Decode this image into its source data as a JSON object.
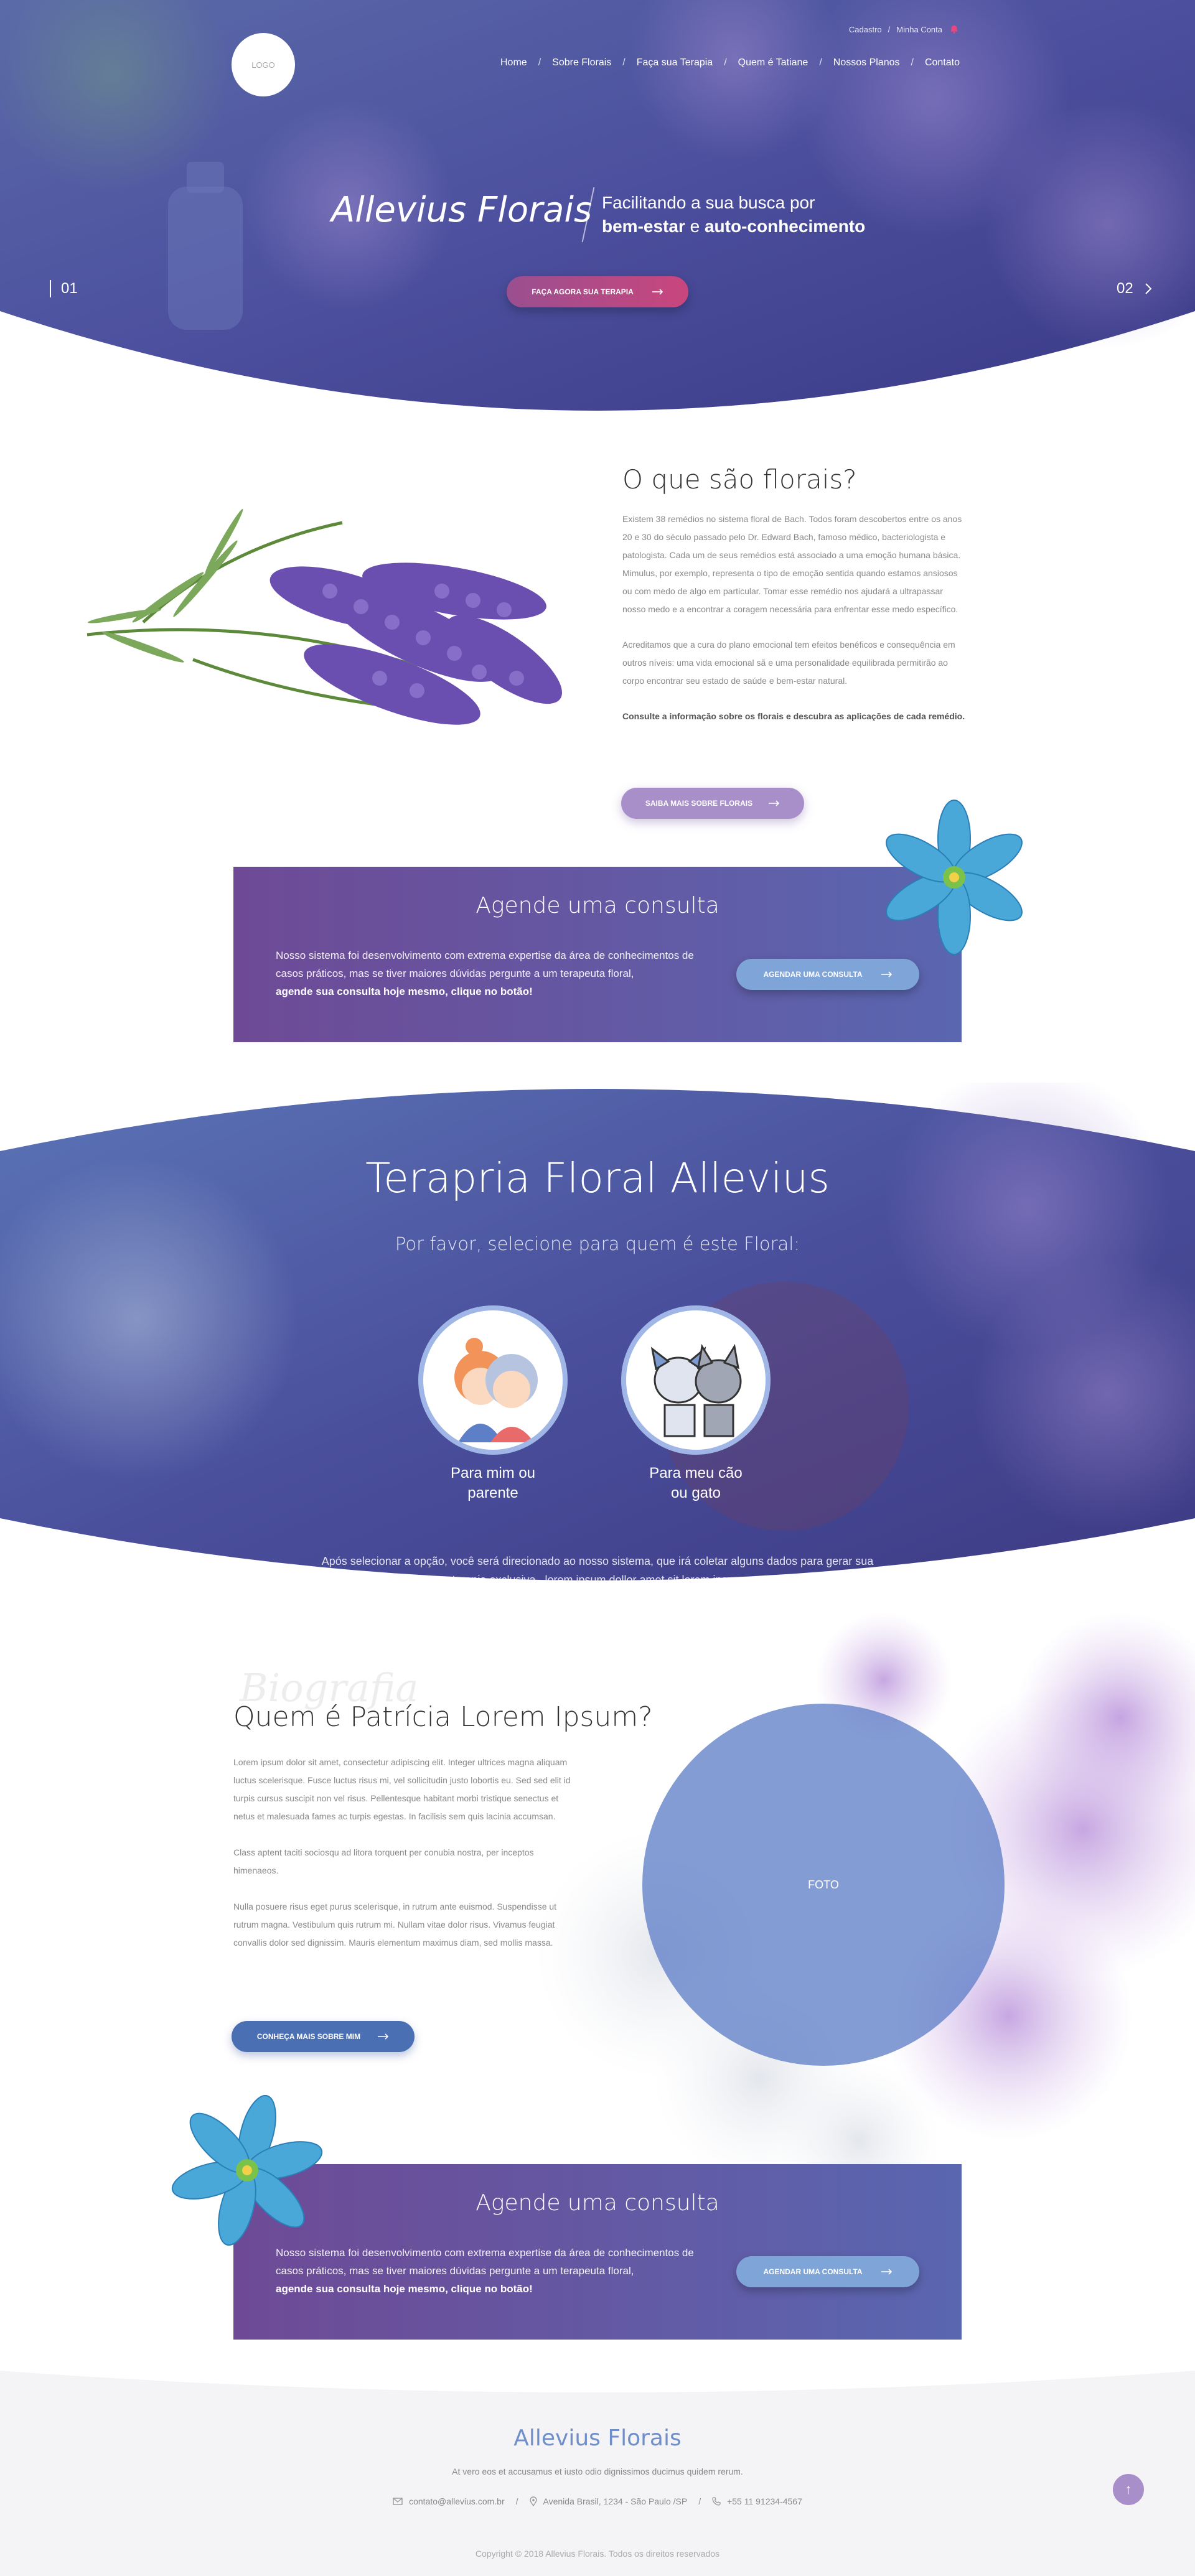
{
  "header": {
    "logo_text": "LOGO",
    "top_links": [
      "Cadastro",
      "/",
      "Minha Conta"
    ],
    "nav": [
      "Home",
      "Sobre Florais",
      "Faça sua Terapia",
      "Quem é Tatiane",
      "Nossos Planos",
      "Contato"
    ],
    "nav_sep": "/"
  },
  "hero": {
    "title": "Allevius Florais",
    "subtitle_line1": "Facilitando a sua busca por",
    "subtitle_b1": "bem-estar",
    "subtitle_mid": " e ",
    "subtitle_b2": "auto-conhecimento",
    "cta_label": "FAÇA AGORA SUA TERAPIA",
    "slide_prev": "01",
    "slide_next": "02"
  },
  "about": {
    "title": "O que são florais?",
    "p1": "Existem 38 remédios no sistema floral de Bach. Todos foram descobertos entre os anos 20 e 30 do século passado pelo Dr. Edward Bach, famoso médico, bacteriologista e patologista. Cada um de seus remédios está associado a uma emoção humana básica. Mimulus, por exemplo, representa o tipo de emoção sentida quando estamos ansiosos ou com medo de algo em particular. Tomar esse remédio nos ajudará a ultrapassar nosso medo e a encontrar a coragem necessária para enfrentar esse medo específico.",
    "p2": "Acreditamos que a cura do plano emocional tem efeitos benéficos e consequência em outros níveis: uma vida emocional sã e uma personalidade equilibrada permitirão ao corpo encontrar seu estado de saúde e bem-estar natural.",
    "p3": "Consulte a informação sobre os florais e descubra as aplicações de cada remédio.",
    "button": "SAIBA MAIS SOBRE FLORAIS"
  },
  "consult": {
    "title": "Agende uma consulta",
    "text": "Nosso sistema foi desenvolvimento com extrema expertise da área de conhecimentos de casos práticos, mas se tiver maiores dúvidas pergunte a um terapeuta floral,",
    "text_bold": "agende sua consulta hoje mesmo, clique no botão!",
    "button": "AGENDAR UMA CONSULTA"
  },
  "therapy": {
    "title": "Terapria Floral Allevius",
    "subtitle": "Por favor, selecione para quem é este Floral:",
    "option1_l1": "Para mim ou",
    "option1_l2": "parente",
    "option2_l1": "Para meu cão",
    "option2_l2": "ou gato",
    "note_l1": "Após selecionar a opção, você será direcionado ao nosso sistema, que irá coletar alguns dados para gerar sua",
    "note_l2": "terapia exclusiva . lorem ipsum dollor amet sit  lorem ipsum"
  },
  "bio": {
    "bg_word": "Biografia",
    "title": "Quem é Patrícia Lorem Ipsum?",
    "p1": " Lorem ipsum dolor sit amet, consectetur adipiscing elit. Integer ultrices magna aliquam luctus scelerisque. Fusce luctus risus mi, vel sollicitudin justo lobortis eu. Sed sed elit id turpis cursus suscipit non vel risus. Pellentesque habitant morbi tristique senectus et netus et malesuada fames ac turpis egestas. In facilisis sem quis lacinia accumsan.",
    "p2": "Class aptent taciti sociosqu ad litora torquent per conubia nostra, per inceptos himenaeos.",
    "p3": "Nulla posuere risus eget purus scelerisque, in rutrum ante euismod. Suspendisse ut rutrum magna. Vestibulum quis rutrum mi. Nullam vitae dolor risus. Vivamus feugiat convallis dolor sed dignissim. Mauris elementum maximus diam, sed mollis massa.",
    "button": "CONHEÇA MAIS SOBRE MIM",
    "photo_label": "FOTO"
  },
  "footer": {
    "title": "Allevius Florais",
    "tagline": "At vero eos et accusamus et iusto odio dignissimos ducimus quidem rerum.",
    "email": "contato@allevius.com.br",
    "address": "Avenida Brasil, 1234 - São Paulo /SP",
    "phone": "+55 11 91234-4567",
    "sep": "/",
    "copyright": "Copyright © 2018 Allevius Florais. Todos os direitos reservados",
    "to_top": "↑"
  },
  "colors": {
    "hero_overlay": "#4c4f9e",
    "purple": "#6e4a96",
    "blue": "#5a66b0",
    "lavender_button": "#a88fca",
    "pink_button": "#c9467d",
    "footer_title": "#6f8fcb"
  }
}
